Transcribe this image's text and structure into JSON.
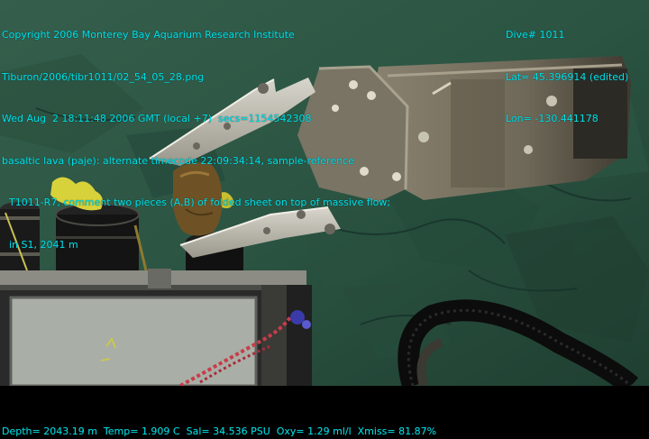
{
  "overlay": {
    "top_left": [
      "Copyright 2006 Monterey Bay Aquarium Research Institute",
      "Tiburon/2006/tibr1011/02_54_05_28.png",
      "Wed Aug  2 18:11:48 2006 GMT (local +7)  secs=1154542308",
      "basaltic lava (paje): alternate timecode 22:09:34:14, sample-reference",
      "T1011-R7, comment two pieces (A,B) of folded sheet on top of massive flow;",
      "in S1, 2041 m"
    ],
    "top_right": [
      "Dive# 1011",
      "Lat= 45.396914 (edited)",
      "Lon= -130.441178"
    ],
    "bottom": "Depth= 2043.19 m  Temp= 1.909 C  Sal= 34.536 PSU  Oxy= 1.29 ml/l  Xmiss= 81.87%"
  },
  "colors": {
    "overlay_text": "#00e0e8",
    "seafloor": "#2f5a44",
    "letterbox": "#000000"
  }
}
